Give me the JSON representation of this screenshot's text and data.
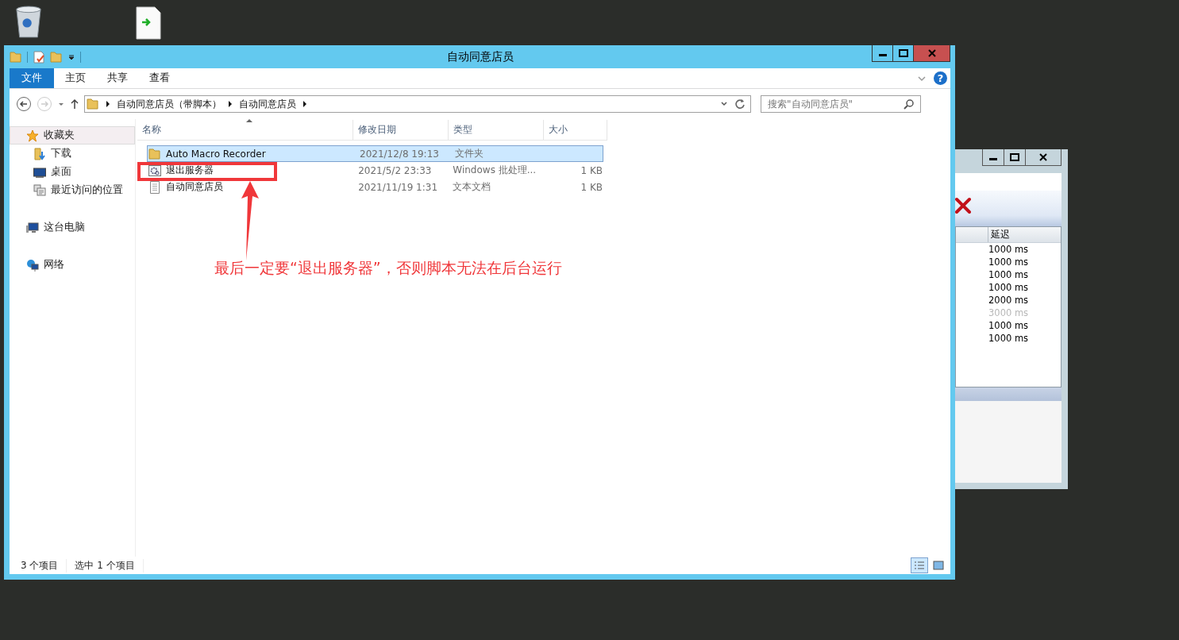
{
  "background_window": {
    "column": "延迟",
    "rows": [
      {
        "delay": "1000 ms",
        "disabled": false
      },
      {
        "delay": "1000 ms",
        "disabled": false
      },
      {
        "delay": "1000 ms",
        "disabled": false
      },
      {
        "delay": "1000 ms",
        "disabled": false
      },
      {
        "delay": "2000 ms",
        "disabled": false
      },
      {
        "delay": "3000 ms",
        "disabled": true
      },
      {
        "delay": "1000 ms",
        "disabled": false
      },
      {
        "delay": "1000 ms",
        "disabled": false
      }
    ]
  },
  "window": {
    "title": "自动同意店员"
  },
  "ribbon_tabs": [
    {
      "label": "文件",
      "selected": true
    },
    {
      "label": "主页",
      "selected": false
    },
    {
      "label": "共享",
      "selected": false
    },
    {
      "label": "查看",
      "selected": false
    }
  ],
  "breadcrumb": [
    "自动同意店员（带脚本）",
    "自动同意店员"
  ],
  "help": "?",
  "search": {
    "placeholder": "搜索\"自动同意店员\""
  },
  "sidebar": {
    "items": [
      {
        "label": "收藏夹",
        "kind": "favorites",
        "selected": true,
        "children": [
          {
            "label": "下载",
            "kind": "downloads",
            "selected": false
          },
          {
            "label": "桌面",
            "kind": "desktop",
            "selected": false
          },
          {
            "label": "最近访问的位置",
            "kind": "recent",
            "selected": false
          }
        ]
      },
      {
        "label": "这台电脑",
        "kind": "computer",
        "selected": false
      },
      {
        "label": "网络",
        "kind": "network",
        "selected": false
      }
    ]
  },
  "table": {
    "columns": [
      "名称",
      "修改日期",
      "类型",
      "大小"
    ],
    "rows": [
      {
        "kind": "folder",
        "name": "Auto Macro Recorder",
        "date": "2021/12/8 19:13",
        "type": "文件夹",
        "selected": true
      },
      {
        "kind": "batch",
        "name": "退出服务器",
        "date": "2021/5/2 23:33",
        "type": "Windows 批处理...",
        "size": "1 KB",
        "selected": false
      },
      {
        "kind": "text",
        "name": "自动同意店员",
        "date": "2021/11/19 1:31",
        "type": "文本文档",
        "size": "1 KB",
        "selected": false
      }
    ]
  },
  "status_bar": {
    "count": "3 个项目",
    "selection": "选中 1 个项目"
  },
  "views": [
    {
      "kind": "details",
      "selected": true
    },
    {
      "kind": "tiles",
      "selected": false
    }
  ],
  "annotation": {
    "text": "最后一定要“退出服务器”，否则脚本无法在后台运行"
  }
}
